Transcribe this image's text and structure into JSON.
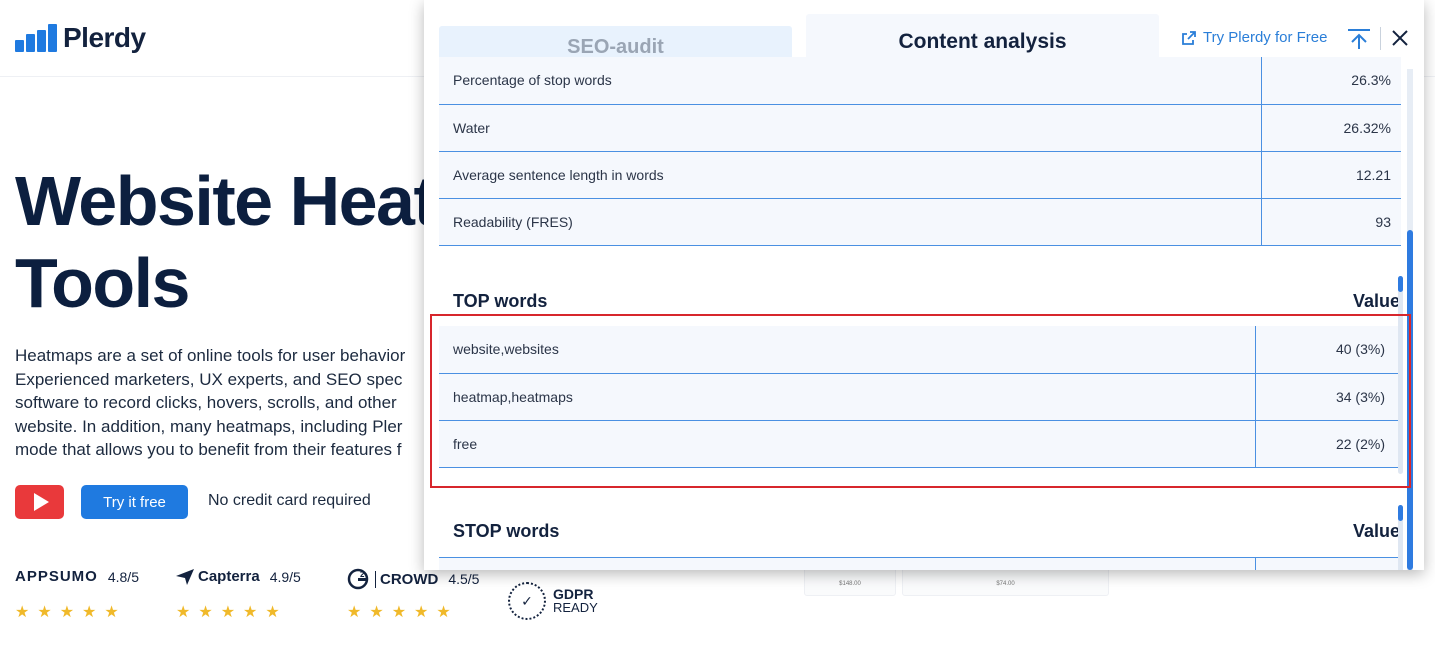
{
  "site": {
    "logo_text": "Plerdy",
    "hero_title_line1": "Website Heat",
    "hero_title_line2": "Tools",
    "hero_paragraph": [
      "Heatmaps are a set of online tools for user behavior",
      "Experienced marketers, UX experts, and SEO spec",
      "software to record clicks, hovers, scrolls, and other",
      "website. In addition, many heatmaps, including Pler",
      "mode that allows you to benefit from their features f"
    ],
    "try_button": "Try it free",
    "no_credit_card": "No credit card required",
    "ratings": [
      {
        "brand": "APPSUMO",
        "score": "4.8/5"
      },
      {
        "brand": "Capterra",
        "score": "4.9/5"
      },
      {
        "brand": "CROWD",
        "score": "4.5/5"
      }
    ],
    "stars": "★★★★★",
    "gdpr_title": "GDPR",
    "gdpr_sub": "READY",
    "mini_card_prices": [
      "$148.00",
      "$74.00"
    ]
  },
  "panel": {
    "tabs": {
      "seo_audit": "SEO-audit",
      "content_analysis": "Content analysis"
    },
    "try_link": "Try Plerdy for Free",
    "metrics": [
      {
        "label": "Percentage of stop words",
        "value": "26.3%"
      },
      {
        "label": "Water",
        "value": "26.32%"
      },
      {
        "label": "Average sentence length in words",
        "value": "12.21"
      },
      {
        "label": "Readability (FRES)",
        "value": "93"
      }
    ],
    "top_words": {
      "heading": "TOP words",
      "value_heading": "Value",
      "rows": [
        {
          "word": "website,websites",
          "value": "40 (3%)"
        },
        {
          "word": "heatmap,heatmaps",
          "value": "34 (3%)"
        },
        {
          "word": "free",
          "value": "22 (2%)"
        }
      ]
    },
    "stop_words": {
      "heading": "STOP words",
      "value_heading": "Value"
    }
  },
  "colors": {
    "accent": "#1f7ae0",
    "highlight": "#d7262c",
    "youtube": "#e9393b",
    "star": "#f0b92a"
  }
}
